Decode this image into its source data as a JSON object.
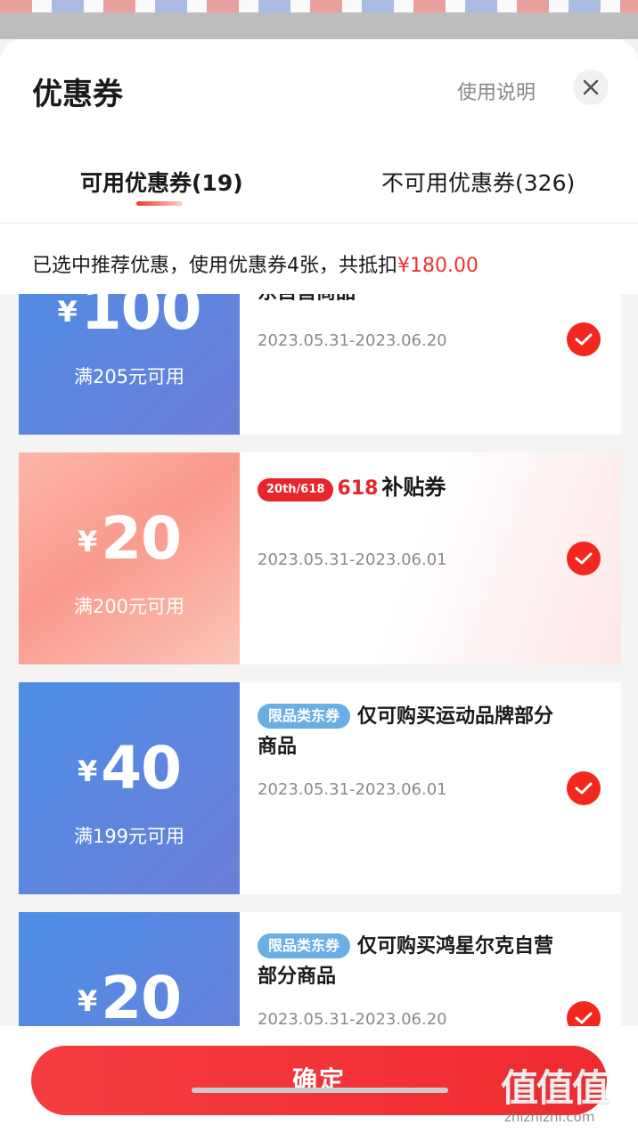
{
  "header": {
    "title": "优惠券",
    "help_link": "使用说明",
    "close_icon": "close-icon"
  },
  "tabs": [
    {
      "label": "可用优惠券(19)",
      "active": true
    },
    {
      "label": "不可用优惠券(326)",
      "active": false
    }
  ],
  "summary": {
    "text": "已选中推荐优惠，使用优惠券4张，共抵扣",
    "amount": "¥180.00"
  },
  "coupons": [
    {
      "currency": "¥",
      "amount": "100",
      "threshold": "满205元可用",
      "title": "东自营商品",
      "validity": "2023.05.31-2023.06.20",
      "selected": true
    },
    {
      "currency": "¥",
      "amount": "20",
      "threshold": "满200元可用",
      "badge": "20th/618",
      "brand": "618",
      "title": "补贴券",
      "validity": "2023.05.31-2023.06.01",
      "selected": true
    },
    {
      "currency": "¥",
      "amount": "40",
      "threshold": "满199元可用",
      "tag": "限品类东券",
      "title": "仅可购买运动品牌部分商品",
      "validity": "2023.05.31-2023.06.01",
      "selected": true
    },
    {
      "currency": "¥",
      "amount": "20",
      "threshold": "",
      "tag": "限品类东券",
      "title": "仅可购买鸿星尔克自营部分商品",
      "validity": "2023.05.31-2023.06.20",
      "selected": true
    }
  ],
  "footer": {
    "confirm_label": "确定"
  },
  "watermark": {
    "logo": "值值值",
    "url": "zhizhizhi.com"
  },
  "colors": {
    "accent": "#f23a2c",
    "coupon_blue": "#5a86e0",
    "tag_blue": "#6aaee6"
  },
  "icons": {
    "check": "check-circle-icon",
    "close": "close-icon"
  }
}
